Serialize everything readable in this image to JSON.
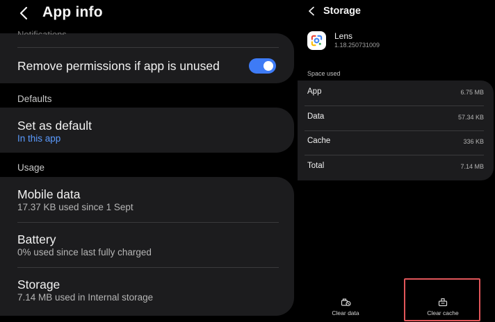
{
  "app_info": {
    "title": "App info",
    "cut_off_text": "Notifications",
    "remove_permissions_label": "Remove permissions if app is unused",
    "remove_permissions_enabled": true,
    "defaults_section": "Defaults",
    "set_as_default": {
      "title": "Set as default",
      "subtitle": "In this app"
    },
    "usage_section": "Usage",
    "mobile_data": {
      "title": "Mobile data",
      "subtitle": "17.37 KB used since 1 Sept"
    },
    "battery": {
      "title": "Battery",
      "subtitle": "0% used since last fully charged"
    },
    "storage": {
      "title": "Storage",
      "subtitle": "7.14 MB used in Internal storage"
    }
  },
  "storage_screen": {
    "title": "Storage",
    "app_name": "Lens",
    "app_version": "1.18.250731009",
    "space_used_label": "Space used",
    "rows": [
      {
        "label": "App",
        "value": "6.75 MB"
      },
      {
        "label": "Data",
        "value": "57.34 KB"
      },
      {
        "label": "Cache",
        "value": "336 KB"
      },
      {
        "label": "Total",
        "value": "7.14 MB"
      }
    ],
    "clear_data_label": "Clear data",
    "clear_cache_label": "Clear cache"
  },
  "colors": {
    "background": "#000000",
    "card": "#1c1c1e",
    "accent_blue": "#3e7bf6",
    "link_blue": "#5b9bff",
    "highlight_red": "#e2565a"
  },
  "icons": {
    "back": "chevron-left-icon",
    "lens": "google-lens-icon",
    "clear_data": "clear-data-icon",
    "clear_cache": "clear-cache-icon"
  }
}
